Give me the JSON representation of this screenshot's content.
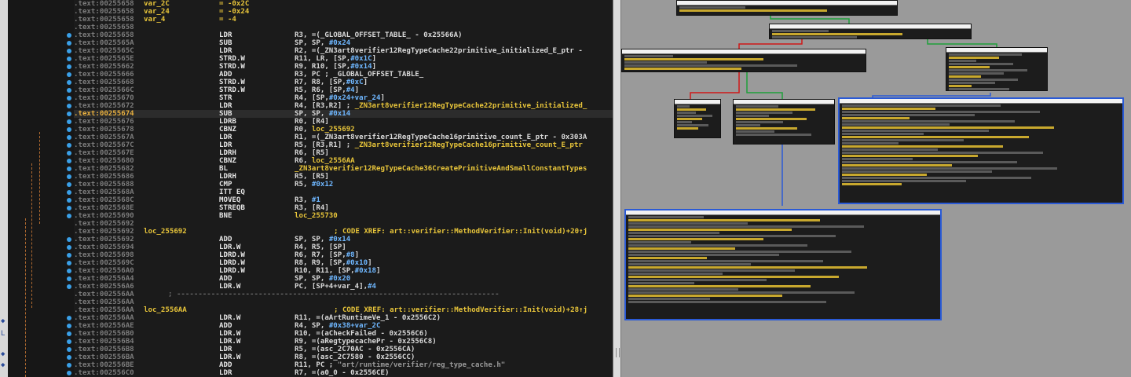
{
  "listing": {
    "rows": [
      {
        "addr": ".text:00255658",
        "label": "var_2C",
        "mn": "",
        "ops": [
          [
            "= -0x2C",
            "s"
          ]
        ]
      },
      {
        "addr": ".text:00255658",
        "label": "var_24",
        "mn": "",
        "ops": [
          [
            "= -0x24",
            "s"
          ]
        ]
      },
      {
        "addr": ".text:00255658",
        "label": "var_4",
        "mn": "",
        "ops": [
          [
            "= -4",
            "s"
          ]
        ]
      },
      {
        "addr": ".text:00255658",
        "label": "",
        "mn": "",
        "ops": []
      },
      {
        "addr": ".text:00255658",
        "label": "",
        "mn": "LDR",
        "ops": [
          [
            "R3, =(_GLOBAL_OFFSET_TABLE_ - 0x25566A)",
            ""
          ]
        ]
      },
      {
        "addr": ".text:0025565A",
        "label": "",
        "mn": "SUB",
        "ops": [
          [
            "SP, SP, ",
            ""
          ],
          [
            "#0x24",
            "n"
          ]
        ]
      },
      {
        "addr": ".text:0025565C",
        "label": "",
        "mn": "LDR",
        "ops": [
          [
            "R2, =(_ZN3art8verifier12RegTypeCache22primitive_initialized_E_ptr - ",
            ""
          ]
        ]
      },
      {
        "addr": ".text:0025565E",
        "label": "",
        "mn": "STRD.W",
        "ops": [
          [
            "R11, LR, [SP,",
            ""
          ],
          [
            "#0x1C",
            "n"
          ],
          [
            "]",
            ""
          ]
        ]
      },
      {
        "addr": ".text:00255662",
        "label": "",
        "mn": "STRD.W",
        "ops": [
          [
            "R9, R10, [SP,",
            ""
          ],
          [
            "#0x14",
            "n"
          ],
          [
            "]",
            ""
          ]
        ]
      },
      {
        "addr": ".text:00255666",
        "label": "",
        "mn": "ADD",
        "ops": [
          [
            "R3, PC ; _GLOBAL_OFFSET_TABLE_",
            ""
          ]
        ]
      },
      {
        "addr": ".text:00255668",
        "label": "",
        "mn": "STRD.W",
        "ops": [
          [
            "R7, R8, [SP,",
            ""
          ],
          [
            "#0xC",
            "n"
          ],
          [
            "]",
            ""
          ]
        ]
      },
      {
        "addr": ".text:0025566C",
        "label": "",
        "mn": "STRD.W",
        "ops": [
          [
            "R5, R6, [SP,",
            ""
          ],
          [
            "#4",
            "n"
          ],
          [
            "]",
            ""
          ]
        ]
      },
      {
        "addr": ".text:00255670",
        "label": "",
        "mn": "STR",
        "ops": [
          [
            "R4, [SP,",
            ""
          ],
          [
            "#0x24+var_24",
            "n"
          ],
          [
            "]",
            ""
          ]
        ]
      },
      {
        "addr": ".text:00255672",
        "label": "",
        "mn": "LDR",
        "ops": [
          [
            "R4, [R3,R2] ; ",
            ""
          ],
          [
            "_ZN3art8verifier12RegTypeCache22primitive_initialized_",
            "s"
          ]
        ]
      },
      {
        "addr": ".text:00255674",
        "label": "",
        "mn": "SUB",
        "ops": [
          [
            "SP, SP, ",
            ""
          ],
          [
            "#0x14",
            "n"
          ]
        ],
        "cur": true
      },
      {
        "addr": ".text:00255676",
        "label": "",
        "mn": "LDRB",
        "ops": [
          [
            "R0, [R4]",
            ""
          ]
        ]
      },
      {
        "addr": ".text:00255678",
        "label": "",
        "mn": "CBNZ",
        "ops": [
          [
            "R0, ",
            ""
          ],
          [
            "loc_255692",
            "s"
          ]
        ]
      },
      {
        "addr": ".text:0025567A",
        "label": "",
        "mn": "LDR",
        "ops": [
          [
            "R1, =(_ZN3art8verifier12RegTypeCache16primitive_count_E_ptr - 0x303A",
            ""
          ]
        ]
      },
      {
        "addr": ".text:0025567C",
        "label": "",
        "mn": "LDR",
        "ops": [
          [
            "R5, [R3,R1] ; ",
            ""
          ],
          [
            "_ZN3art8verifier12RegTypeCache16primitive_count_E_ptr",
            "s"
          ]
        ]
      },
      {
        "addr": ".text:0025567E",
        "label": "",
        "mn": "LDRH",
        "ops": [
          [
            "R6, [R5]",
            ""
          ]
        ]
      },
      {
        "addr": ".text:00255680",
        "label": "",
        "mn": "CBNZ",
        "ops": [
          [
            "R6, ",
            ""
          ],
          [
            "loc_2556AA",
            "s"
          ]
        ]
      },
      {
        "addr": ".text:00255682",
        "label": "",
        "mn": "BL",
        "ops": [
          [
            "_ZN3art8verifier12RegTypeCache36CreatePrimitiveAndSmallConstantTypes",
            "s"
          ]
        ]
      },
      {
        "addr": ".text:00255686",
        "label": "",
        "mn": "LDRH",
        "ops": [
          [
            "R5, [R5]",
            ""
          ]
        ]
      },
      {
        "addr": ".text:00255688",
        "label": "",
        "mn": "CMP",
        "ops": [
          [
            "R5, ",
            ""
          ],
          [
            "#0x12",
            "n"
          ]
        ]
      },
      {
        "addr": ".text:0025568A",
        "label": "",
        "mn": "ITT EQ",
        "ops": []
      },
      {
        "addr": ".text:0025568C",
        "label": "",
        "mn": "MOVEQ",
        "ops": [
          [
            "R3, ",
            ""
          ],
          [
            "#1",
            "n"
          ]
        ]
      },
      {
        "addr": ".text:0025568E",
        "label": "",
        "mn": "STREQB",
        "ops": [
          [
            "R3, [R4]",
            ""
          ]
        ]
      },
      {
        "addr": ".text:00255690",
        "label": "",
        "mn": "BNE",
        "ops": [
          [
            "loc_255730",
            "s"
          ]
        ]
      },
      {
        "addr": ".text:00255692",
        "label": "",
        "mn": "",
        "ops": []
      },
      {
        "addr": ".text:00255692",
        "label": "loc_255692",
        "mn": "",
        "ops": [],
        "xref": "; CODE XREF: art::verifier::MethodVerifier::Init(void)+20↑j"
      },
      {
        "addr": ".text:00255692",
        "label": "",
        "mn": "ADD",
        "ops": [
          [
            "SP, SP, ",
            ""
          ],
          [
            "#0x14",
            "n"
          ]
        ]
      },
      {
        "addr": ".text:00255694",
        "label": "",
        "mn": "LDR.W",
        "ops": [
          [
            "R4, R5, [SP]",
            ""
          ]
        ]
      },
      {
        "addr": ".text:00255698",
        "label": "",
        "mn": "LDRD.W",
        "ops": [
          [
            "R6, R7, [SP,",
            ""
          ],
          [
            "#8",
            "n"
          ],
          [
            "]",
            ""
          ]
        ]
      },
      {
        "addr": ".text:0025569C",
        "label": "",
        "mn": "LDRD.W",
        "ops": [
          [
            "R8, R9, [SP,",
            ""
          ],
          [
            "#0x10",
            "n"
          ],
          [
            "]",
            ""
          ]
        ]
      },
      {
        "addr": ".text:002556A0",
        "label": "",
        "mn": "LDRD.W",
        "ops": [
          [
            "R10, R11, [SP,",
            ""
          ],
          [
            "#0x18",
            "n"
          ],
          [
            "]",
            ""
          ]
        ]
      },
      {
        "addr": ".text:002556A4",
        "label": "",
        "mn": "ADD",
        "ops": [
          [
            "SP, SP, ",
            ""
          ],
          [
            "#0x20",
            "n"
          ]
        ]
      },
      {
        "addr": ".text:002556A6",
        "label": "",
        "mn": "LDR.W",
        "ops": [
          [
            "PC, [SP+4+var_4],",
            ""
          ],
          [
            "#4",
            "n"
          ]
        ]
      },
      {
        "addr": ".text:002556AA",
        "label": "",
        "mn": "",
        "ops": [],
        "sep": "; ---------------------------------------------------------------------------"
      },
      {
        "addr": ".text:002556AA",
        "label": "",
        "mn": "",
        "ops": []
      },
      {
        "addr": ".text:002556AA",
        "label": "loc_2556AA",
        "mn": "",
        "ops": [],
        "xref": "; CODE XREF: art::verifier::MethodVerifier::Init(void)+28↑j"
      },
      {
        "addr": ".text:002556AA",
        "label": "",
        "mn": "LDR.W",
        "ops": [
          [
            "R11, =(aArtRuntimeVe_1 - 0x2556C2)",
            ""
          ]
        ]
      },
      {
        "addr": ".text:002556AE",
        "label": "",
        "mn": "ADD",
        "ops": [
          [
            "R4, SP, ",
            ""
          ],
          [
            "#0x38+var_2C",
            "n"
          ]
        ]
      },
      {
        "addr": ".text:002556B0",
        "label": "",
        "mn": "LDR.W",
        "ops": [
          [
            "R10, =(aCheckFailed - 0x2556C6)",
            ""
          ]
        ]
      },
      {
        "addr": ".text:002556B4",
        "label": "",
        "mn": "LDR.W",
        "ops": [
          [
            "R9, =(aRegtypecachePr - 0x2556C8)",
            ""
          ]
        ]
      },
      {
        "addr": ".text:002556B8",
        "label": "",
        "mn": "LDR",
        "ops": [
          [
            "R5, =(asc_2C70AC - 0x2556CA)",
            ""
          ]
        ]
      },
      {
        "addr": ".text:002556BA",
        "label": "",
        "mn": "LDR.W",
        "ops": [
          [
            "R8, =(asc_2C7580 - 0x2556CC)",
            ""
          ]
        ]
      },
      {
        "addr": ".text:002556BE",
        "label": "",
        "mn": "ADD",
        "ops": [
          [
            "R11, PC ; ",
            ""
          ],
          [
            "\"art/runtime/verifier/reg_type_cache.h\"",
            "cmt"
          ]
        ]
      },
      {
        "addr": ".text:002556C0",
        "label": "",
        "mn": "LDR",
        "ops": [
          [
            "R7, =(a0_0 - 0x2556CE)",
            ""
          ]
        ]
      }
    ]
  },
  "colors": {
    "listing_bg": "#1b1b1b",
    "address": "#7b7b7b",
    "label": "#e8c53a",
    "number": "#6fb7ff",
    "graph_bg": "#9a9a9a",
    "selected_border": "#2a5ad6",
    "edge_green": "#1ea03a",
    "edge_red": "#d01818",
    "edge_blue": "#2a5ad6"
  }
}
